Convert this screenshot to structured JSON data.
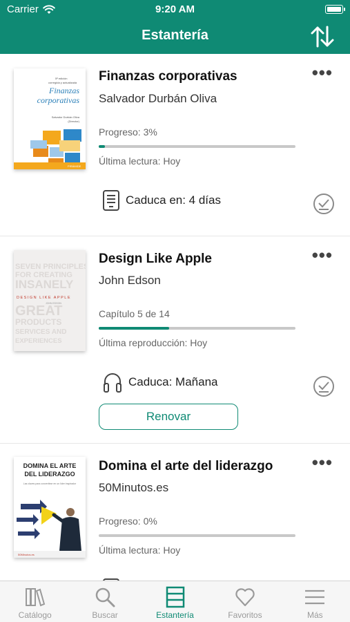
{
  "status": {
    "carrier": "Carrier",
    "time": "9:20 AM",
    "battery_level": 1.0
  },
  "nav": {
    "title": "Estantería",
    "sort_icon": "sort-arrows-icon"
  },
  "books": [
    {
      "cover": {
        "edition": "5ª edición",
        "subtitle": "corregida y actualizada",
        "title": "Finanzas corporativas",
        "author": "Salvador Durbán Oliva",
        "role": "(Director)",
        "publisher": "PIRÁMIDE"
      },
      "title": "Finanzas corporativas",
      "author": "Salvador Durbán Oliva",
      "progress_label": "Progreso: 3%",
      "progress": 0.03,
      "last_read": "Última lectura: Hoy",
      "expiry": "Caduca en: 4 días",
      "expiry_icon": "ebook-icon"
    },
    {
      "cover": {
        "lines": [
          "SEVEN PRINCIPLES",
          "FOR CREATING",
          "INSANELY",
          "GREAT",
          "PRODUCTS",
          "SERVICES AND",
          "EXPERIENCES"
        ],
        "banner": "DESIGN LIKE APPLE",
        "byline": "JOHN EDSON"
      },
      "title": "Design Like Apple",
      "author": "John Edson",
      "progress_label": "Capítulo 5 de 14",
      "progress": 0.357,
      "last_read": "Última reproducción: Hoy",
      "expiry": "Caduca: Mañana",
      "expiry_icon": "headphones-icon",
      "renew_label": "Renovar"
    },
    {
      "cover": {
        "title_line1": "DOMINA EL ARTE",
        "title_line2": "DEL LIDERAZGO",
        "subtitle": "Las claves para convertirse en un líder inspirador",
        "publisher": "50Minutos.es"
      },
      "title": "Domina el arte del liderazgo",
      "author": "50Minutos.es",
      "progress_label": "Progreso: 0%",
      "progress": 0.0,
      "last_read": "Última lectura: Hoy"
    }
  ],
  "tabs": [
    {
      "label": "Catálogo",
      "icon": "books-icon",
      "active": false
    },
    {
      "label": "Buscar",
      "icon": "search-icon",
      "active": false
    },
    {
      "label": "Estantería",
      "icon": "shelf-icon",
      "active": true
    },
    {
      "label": "Favoritos",
      "icon": "heart-icon",
      "active": false
    },
    {
      "label": "Más",
      "icon": "menu-icon",
      "active": false
    }
  ],
  "colors": {
    "accent": "#0f8a74",
    "bar_track": "#c8c8c8",
    "tab_inactive": "#9a9a9a"
  }
}
